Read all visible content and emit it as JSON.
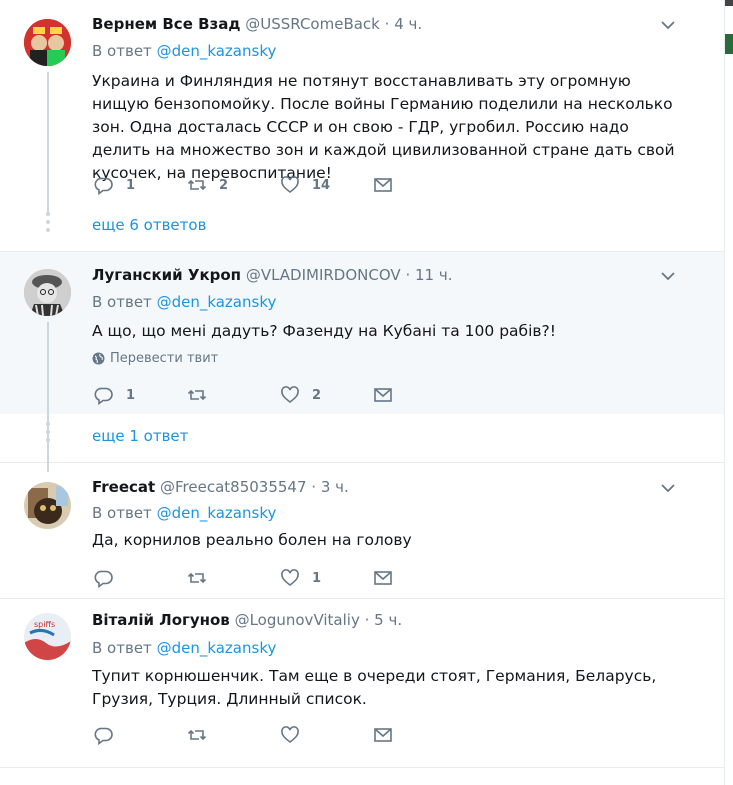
{
  "tweets": [
    {
      "name": "Вернем Все Взад",
      "handle": "@USSRComeBack",
      "time": "· 4 ч.",
      "reply_prefix": "В ответ",
      "reply_to": "@den_kazansky",
      "text": "Украина и Финляндия не потянут восстанавливать эту огромную нищую бензопомойку. После войны Германию поделили на несколько зон. Одна досталась СССР и он свою - ГДР, угробил. Россию надо делить на множество зон и каждой цивилизованной стране дать свой кусочек, на перевоспитание!",
      "replies": "1",
      "retweets": "2",
      "likes": "14",
      "more_replies": "еще 6 ответов"
    },
    {
      "name": "Луганский Укроп",
      "handle": "@VLADIMIRDONCOV",
      "time": "· 11 ч.",
      "reply_prefix": "В ответ",
      "reply_to": "@den_kazansky",
      "text": "А що, що мені дадуть? Фазенду на Кубані та 100 рабів?!",
      "translate": "Перевести твит",
      "replies": "1",
      "retweets": "",
      "likes": "2",
      "more_replies": "еще 1 ответ"
    },
    {
      "name": "Freecat",
      "handle": "@Freecat85035547",
      "time": "· 3 ч.",
      "reply_prefix": "В ответ",
      "reply_to": "@den_kazansky",
      "text": "Да, корнилов реально болен на голову",
      "replies": "",
      "retweets": "",
      "likes": "1"
    },
    {
      "name": "Віталій Логунов",
      "handle": "@LogunovVitaliy",
      "time": "· 5 ч.",
      "reply_prefix": "В ответ",
      "reply_to": "@den_kazansky",
      "text": "Тупит корнюшенчик. Там еще в очереди стоят, Германия, Беларусь, Грузия, Турция. Длинный список.",
      "replies": "",
      "retweets": "",
      "likes": ""
    }
  ],
  "colors": {
    "link": "#1b95e0",
    "muted": "#657786",
    "text": "#14171a",
    "highlight_bg": "#f5f8fa"
  },
  "icons": [
    "reply-icon",
    "retweet-icon",
    "like-icon",
    "direct-message-icon",
    "chevron-down-icon",
    "globe-icon"
  ]
}
